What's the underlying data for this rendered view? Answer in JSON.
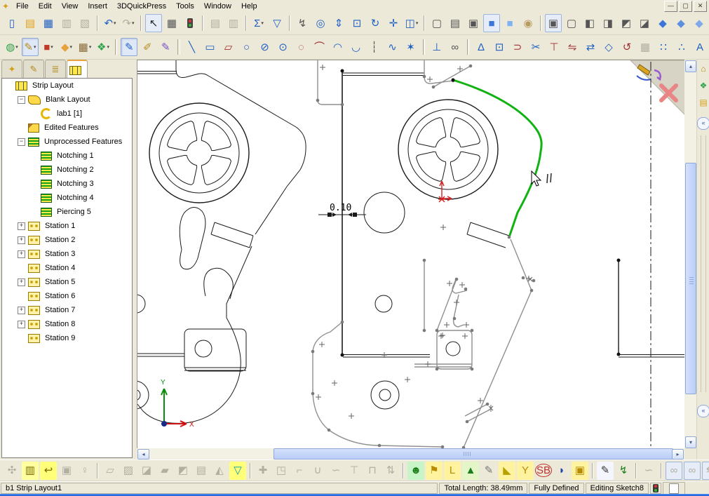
{
  "window": {
    "app_icon": "✦",
    "menu": [
      "File",
      "Edit",
      "View",
      "Insert",
      "3DQuickPress",
      "Tools",
      "Window",
      "Help"
    ],
    "window_buttons": [
      {
        "name": "minimize-button",
        "glyph": "—"
      },
      {
        "name": "restore-button",
        "glyph": "▢"
      },
      {
        "name": "close-button",
        "glyph": "✕"
      }
    ]
  },
  "toolbar_main": [
    {
      "name": "new-document-button",
      "glyph": "▯",
      "color": "#1f5fc4"
    },
    {
      "name": "open-document-button",
      "glyph": "▤",
      "color": "#e0a11b"
    },
    {
      "name": "save-button",
      "glyph": "▦",
      "color": "#1f5fc4"
    },
    {
      "name": "make-drawing-button",
      "glyph": "▥",
      "gray": true
    },
    {
      "name": "make-assembly-button",
      "glyph": "▧",
      "gray": true
    },
    {
      "sep": true
    },
    {
      "name": "undo-button",
      "glyph": "↶",
      "color": "#1f5fc4",
      "caret": true
    },
    {
      "name": "redo-button",
      "glyph": "↷",
      "gray": true,
      "caret": true
    },
    {
      "sep": true
    },
    {
      "name": "select-arrow-button",
      "glyph": "↖",
      "color": "#222",
      "boxed": true
    },
    {
      "name": "sketch-grid-button",
      "glyph": "▦",
      "color": "#555"
    },
    {
      "name": "traffic-light-button",
      "cls": "ic-traffic"
    },
    {
      "sep": true
    },
    {
      "name": "print-button",
      "glyph": "▤",
      "gray": true
    },
    {
      "name": "print-preview-button",
      "glyph": "▥",
      "gray": true
    },
    {
      "sep": true
    },
    {
      "name": "measure-tool-button",
      "glyph": "Σ",
      "color": "#1f5fc4",
      "caret": true
    },
    {
      "name": "selection-filter-toggle-button",
      "glyph": "▽",
      "color": "#1f5fc4"
    },
    {
      "sep": true
    },
    {
      "name": "filter-lightning-button",
      "glyph": "↯",
      "color": "#555"
    },
    {
      "name": "zoom-to-fit-button",
      "glyph": "◎",
      "color": "#1f5fc4"
    },
    {
      "name": "zoom-in-out-button",
      "glyph": "⇕",
      "color": "#1f5fc4"
    },
    {
      "name": "zoom-to-area-button",
      "glyph": "⊡",
      "color": "#1f5fc4"
    },
    {
      "name": "rotate-view-button",
      "glyph": "↻",
      "color": "#1f5fc4"
    },
    {
      "name": "pan-button",
      "glyph": "✛",
      "color": "#1f5fc4"
    },
    {
      "name": "section-view-button",
      "glyph": "◫",
      "color": "#1f5fc4",
      "caret": true
    },
    {
      "sep": true
    },
    {
      "name": "wireframe-button",
      "glyph": "▢",
      "color": "#555"
    },
    {
      "name": "hidden-lines-visible-button",
      "glyph": "▤",
      "color": "#555"
    },
    {
      "name": "hidden-lines-removed-button",
      "glyph": "▣",
      "color": "#555"
    },
    {
      "name": "shaded-with-edges-button",
      "glyph": "■",
      "color": "#3b76d8",
      "boxed": true
    },
    {
      "name": "shaded-button",
      "glyph": "■",
      "color": "#7fb2f0"
    },
    {
      "name": "realview-button",
      "glyph": "◉",
      "color": "#b89b5e"
    },
    {
      "sep": true
    },
    {
      "name": "view-front-button",
      "glyph": "▣",
      "color": "#555",
      "boxed": true
    },
    {
      "name": "view-back-button",
      "glyph": "▢",
      "color": "#555"
    },
    {
      "name": "view-left-button",
      "glyph": "◧",
      "color": "#555"
    },
    {
      "name": "view-right-button",
      "glyph": "◨",
      "color": "#555"
    },
    {
      "name": "view-top-button",
      "glyph": "◩",
      "color": "#555"
    },
    {
      "name": "view-bottom-button",
      "glyph": "◪",
      "color": "#555"
    },
    {
      "name": "view-isometric-button",
      "glyph": "◆",
      "color": "#3b76d8"
    },
    {
      "name": "view-trimetric-button",
      "glyph": "◆",
      "color": "#5d8fe0"
    },
    {
      "name": "view-dimetric-button",
      "glyph": "◆",
      "color": "#7fa9ea"
    },
    {
      "name": "normal-to-button",
      "glyph": "∟",
      "color": "#1f5fc4"
    },
    {
      "name": "view-orientation-button",
      "glyph": "⊕",
      "color": "#555"
    }
  ],
  "toolbar_sketch": [
    {
      "name": "qp-scene-dropdown-button",
      "glyph": "◍",
      "color": "#2fa34c",
      "caret": true
    },
    {
      "name": "qp-sketch-dropdown-button",
      "glyph": "✎",
      "color": "#b58a1f",
      "caret": true,
      "pressed": true
    },
    {
      "name": "qp-solidworks-button",
      "glyph": "■",
      "color": "#c23b2a",
      "caret": true
    },
    {
      "name": "qp-insert-feature-button",
      "glyph": "◆",
      "color": "#e8a33d",
      "caret": true
    },
    {
      "name": "qp-die-set-button",
      "glyph": "▦",
      "color": "#8a6d3b",
      "caret": true
    },
    {
      "name": "qp-tooling-button",
      "glyph": "❖",
      "color": "#2fa34c",
      "caret": true
    },
    {
      "sep": true
    },
    {
      "name": "sketch-button",
      "glyph": "✎",
      "color": "#1f5fc4",
      "pressed": true
    },
    {
      "name": "3d-sketch-button",
      "glyph": "✐",
      "color": "#b58a1f"
    },
    {
      "name": "modify-sketch-button",
      "glyph": "✎",
      "color": "#7a4fc4"
    },
    {
      "sep": true
    },
    {
      "name": "line-tool-button",
      "glyph": "╲",
      "color": "#1f5fc4"
    },
    {
      "name": "rectangle-tool-button",
      "glyph": "▭",
      "color": "#1f5fc4"
    },
    {
      "name": "parallelogram-tool-button",
      "glyph": "▱",
      "color": "#a03030"
    },
    {
      "name": "circle-tool-button",
      "glyph": "○",
      "color": "#1f5fc4"
    },
    {
      "name": "ellipse-tool-button",
      "glyph": "⊘",
      "color": "#1f5fc4"
    },
    {
      "name": "polygon-tool-button",
      "glyph": "⊙",
      "color": "#1f5fc4"
    },
    {
      "name": "perimeter-circle-tool-button",
      "glyph": "◌",
      "color": "#a03030"
    },
    {
      "name": "three-point-arc-tool-button",
      "glyph": "⌒",
      "color": "#a03030"
    },
    {
      "name": "tangent-arc-tool-button",
      "glyph": "◠",
      "color": "#1f5fc4"
    },
    {
      "name": "centerpoint-arc-tool-button",
      "glyph": "◡",
      "color": "#1f5fc4"
    },
    {
      "name": "centerline-tool-button",
      "glyph": "┆",
      "color": "#555"
    },
    {
      "name": "spline-tool-button",
      "glyph": "∿",
      "color": "#1f5fc4"
    },
    {
      "name": "point-tool-button",
      "glyph": "✶",
      "color": "#1f5fc4"
    },
    {
      "sep": true
    },
    {
      "name": "add-relation-button",
      "glyph": "⊥",
      "color": "#1f5fc4"
    },
    {
      "name": "display-relations-button",
      "glyph": "∞",
      "color": "#555"
    },
    {
      "sep": true
    },
    {
      "name": "smart-dimension-button",
      "glyph": "Δ",
      "color": "#1f5fc4"
    },
    {
      "name": "convert-entities-button",
      "glyph": "⊡",
      "color": "#1f5fc4"
    },
    {
      "name": "offset-entities-button",
      "glyph": "⊃",
      "color": "#a03030"
    },
    {
      "name": "trim-entities-button",
      "glyph": "✂",
      "color": "#1f5fc4"
    },
    {
      "name": "extend-entities-button",
      "glyph": "⊤",
      "color": "#a03030"
    },
    {
      "name": "mirror-entities-button",
      "glyph": "⇋",
      "color": "#a03030"
    },
    {
      "name": "move-entities-button",
      "glyph": "⇄",
      "color": "#1f5fc4"
    },
    {
      "name": "dynamic-mirror-button",
      "glyph": "◇",
      "color": "#1f5fc4"
    },
    {
      "name": "modify-entities-button",
      "glyph": "↺",
      "color": "#a03030"
    },
    {
      "name": "sketch-picture-button",
      "glyph": "▦",
      "gray": true
    },
    {
      "name": "linear-pattern-button",
      "glyph": "∷",
      "color": "#1f5fc4"
    },
    {
      "name": "circular-pattern-button",
      "glyph": "∴",
      "color": "#1f5fc4"
    },
    {
      "name": "sketch-text-button",
      "glyph": "A",
      "color": "#1f5fc4"
    }
  ],
  "qp_toolbar": [
    {
      "name": "qp-strip-process-button",
      "glyph": "✣",
      "gray": true
    },
    {
      "name": "qp-strip-layout-button",
      "glyph": "▥",
      "color": "#7a6a00",
      "bg": "#ffff9e"
    },
    {
      "name": "qp-unfold-button",
      "glyph": "↩",
      "color": "#7a6a00",
      "bg": "#ffff7a"
    },
    {
      "name": "qp-press-button",
      "glyph": "▣",
      "gray": true
    },
    {
      "name": "qp-lamp-button",
      "glyph": "♀",
      "gray": true
    },
    {
      "sep": true
    },
    {
      "name": "qp-bend-flat-button",
      "glyph": "▱",
      "gray": true
    },
    {
      "name": "qp-bend-up-button",
      "glyph": "▨",
      "gray": true
    },
    {
      "name": "qp-bend-down-button",
      "glyph": "◪",
      "gray": true
    },
    {
      "name": "qp-bend-edge-button",
      "glyph": "▰",
      "gray": true
    },
    {
      "name": "qp-bend-hem-button",
      "glyph": "◩",
      "gray": true
    },
    {
      "name": "qp-bend-table-button",
      "glyph": "▤",
      "gray": true
    },
    {
      "name": "qp-bend-wipe-button",
      "glyph": "◭",
      "gray": true
    },
    {
      "name": "qp-funnel-button",
      "glyph": "▽",
      "color": "#0a9aa8",
      "bg": "#ffff7a"
    },
    {
      "sep": true
    },
    {
      "name": "qp-weld-button",
      "glyph": "✚",
      "gray": true
    },
    {
      "name": "qp-stamp-button",
      "glyph": "◳",
      "gray": true
    },
    {
      "name": "qp-joggle-button",
      "glyph": "⌐",
      "gray": true
    },
    {
      "name": "qp-u-bend-button",
      "glyph": "∪",
      "gray": true
    },
    {
      "name": "qp-wave-form-button",
      "glyph": "∽",
      "gray": true
    },
    {
      "name": "qp-t-punch-button",
      "glyph": "⊤",
      "gray": true
    },
    {
      "name": "qp-channel-button",
      "glyph": "⊓",
      "gray": true
    },
    {
      "name": "qp-lift-button",
      "glyph": "⇅",
      "gray": true
    },
    {
      "sep": true
    },
    {
      "name": "qp-part-view-button",
      "glyph": "☻",
      "color": "#1b7e1b",
      "bg": "#c8f5c8"
    },
    {
      "name": "qp-flag-button",
      "glyph": "⚑",
      "color": "#b88a00",
      "bg": "#fff3a0"
    },
    {
      "name": "qp-bend-line-button",
      "glyph": "L",
      "color": "#b88a00",
      "bg": "#fff3a0"
    },
    {
      "name": "qp-forming-button",
      "glyph": "▲",
      "color": "#1b7e1b",
      "bg": "#e4f5c8"
    },
    {
      "name": "qp-sketch-check-button",
      "glyph": "✎",
      "color": "#777"
    },
    {
      "name": "qp-funnel-flag-button",
      "glyph": "◣",
      "color": "#b8a000",
      "bg": "#fff3a0"
    },
    {
      "name": "qp-y-tool-button",
      "glyph": "Y",
      "color": "#b88a00",
      "bg": "#fff3a0"
    },
    {
      "name": "qp-sb-button",
      "glyph": "SB",
      "cls": "ic-sb"
    },
    {
      "name": "qp-shield-button",
      "glyph": "◗",
      "color": "#2244aa"
    },
    {
      "name": "qp-die-lock-button",
      "glyph": "▣",
      "color": "#b88a00",
      "bg": "#fff3a0"
    },
    {
      "sep": true
    },
    {
      "name": "qp-notes-button",
      "glyph": "✎",
      "color": "#333",
      "bg": "#f5f5ff"
    },
    {
      "name": "qp-export-button",
      "glyph": "↯",
      "color": "#1b7e1b"
    },
    {
      "sep": true
    },
    {
      "name": "qp-hidden-tool-button",
      "glyph": "∽",
      "gray": true
    },
    {
      "sep": true
    },
    {
      "name": "qp-link-a-button",
      "glyph": "∞",
      "gray": true,
      "boxed": true
    },
    {
      "name": "qp-link-b-button",
      "glyph": "∞",
      "gray": true,
      "boxed": true
    },
    {
      "name": "qp-swap-button",
      "glyph": "⇆",
      "gray": true,
      "boxed": true
    },
    {
      "name": "qp-import-button",
      "glyph": "⇥",
      "color": "#a03030",
      "boxed": true
    },
    {
      "name": "qp-delete-button",
      "glyph": "⊠",
      "color": "#c03030",
      "boxed": true
    }
  ],
  "panel": {
    "tabs": [
      {
        "name": "featuremanager-tab",
        "glyph": "✦",
        "color": "#d4a017"
      },
      {
        "name": "propertymanager-tab",
        "glyph": "✎",
        "color": "#b58a1f"
      },
      {
        "name": "configurationmanager-tab",
        "glyph": "≣",
        "color": "#b58a1f"
      },
      {
        "name": "striplayout-tab",
        "glyph": "",
        "icon_cls": "ti-strip",
        "active": true
      }
    ],
    "tree": [
      {
        "label": "Strip Layout",
        "icon": "strip",
        "level": 0,
        "expander": ""
      },
      {
        "label": "Blank Layout",
        "icon": "blank",
        "level": 1,
        "expander": "minus"
      },
      {
        "label": "lab1 [1]",
        "icon": "part",
        "level": 2,
        "expander": ""
      },
      {
        "label": "Edited Features",
        "icon": "edited",
        "level": 1,
        "expander": ""
      },
      {
        "label": "Unprocessed Features",
        "icon": "unproc",
        "level": 1,
        "expander": "minus"
      },
      {
        "label": "Notching 1",
        "icon": "notch",
        "level": 2,
        "expander": ""
      },
      {
        "label": "Notching 2",
        "icon": "notch",
        "level": 2,
        "expander": ""
      },
      {
        "label": "Notching 3",
        "icon": "notch",
        "level": 2,
        "expander": ""
      },
      {
        "label": "Notching 4",
        "icon": "notch",
        "level": 2,
        "expander": ""
      },
      {
        "label": "Piercing 5",
        "icon": "notch",
        "level": 2,
        "expander": ""
      },
      {
        "label": "Station 1",
        "icon": "station",
        "level": 1,
        "expander": "plus"
      },
      {
        "label": "Station 2",
        "icon": "station",
        "level": 1,
        "expander": "plus"
      },
      {
        "label": "Station 3",
        "icon": "station",
        "level": 1,
        "expander": "plus"
      },
      {
        "label": "Station 4",
        "icon": "station",
        "level": 1,
        "expander": ""
      },
      {
        "label": "Station 5",
        "icon": "station",
        "level": 1,
        "expander": "plus"
      },
      {
        "label": "Station 6",
        "icon": "station",
        "level": 1,
        "expander": ""
      },
      {
        "label": "Station 7",
        "icon": "station",
        "level": 1,
        "expander": "plus"
      },
      {
        "label": "Station 8",
        "icon": "station",
        "level": 1,
        "expander": "plus"
      },
      {
        "label": "Station 9",
        "icon": "station",
        "level": 1,
        "expander": ""
      }
    ]
  },
  "viewport": {
    "dimension_label": "0.10",
    "axis_x_label": "X",
    "axis_y_label": "Y",
    "selected_color": "#12b212",
    "sketch_gray": "#8f8f8f"
  },
  "taskpane": {
    "icons": [
      {
        "name": "home-icon-button",
        "glyph": "⌂",
        "color": "#b8860b"
      },
      {
        "name": "resources-icon-button",
        "glyph": "❖",
        "color": "#2fa34c"
      },
      {
        "name": "file-explorer-icon-button",
        "glyph": "▤",
        "color": "#d4a017"
      }
    ],
    "collapse_glyph": "«"
  },
  "statusbar": {
    "left_text": "b1 Strip Layout1",
    "total_length": "Total Length: 38.49mm",
    "constraint_state": "Fully Defined",
    "editing_state": "Editing Sketch8"
  }
}
